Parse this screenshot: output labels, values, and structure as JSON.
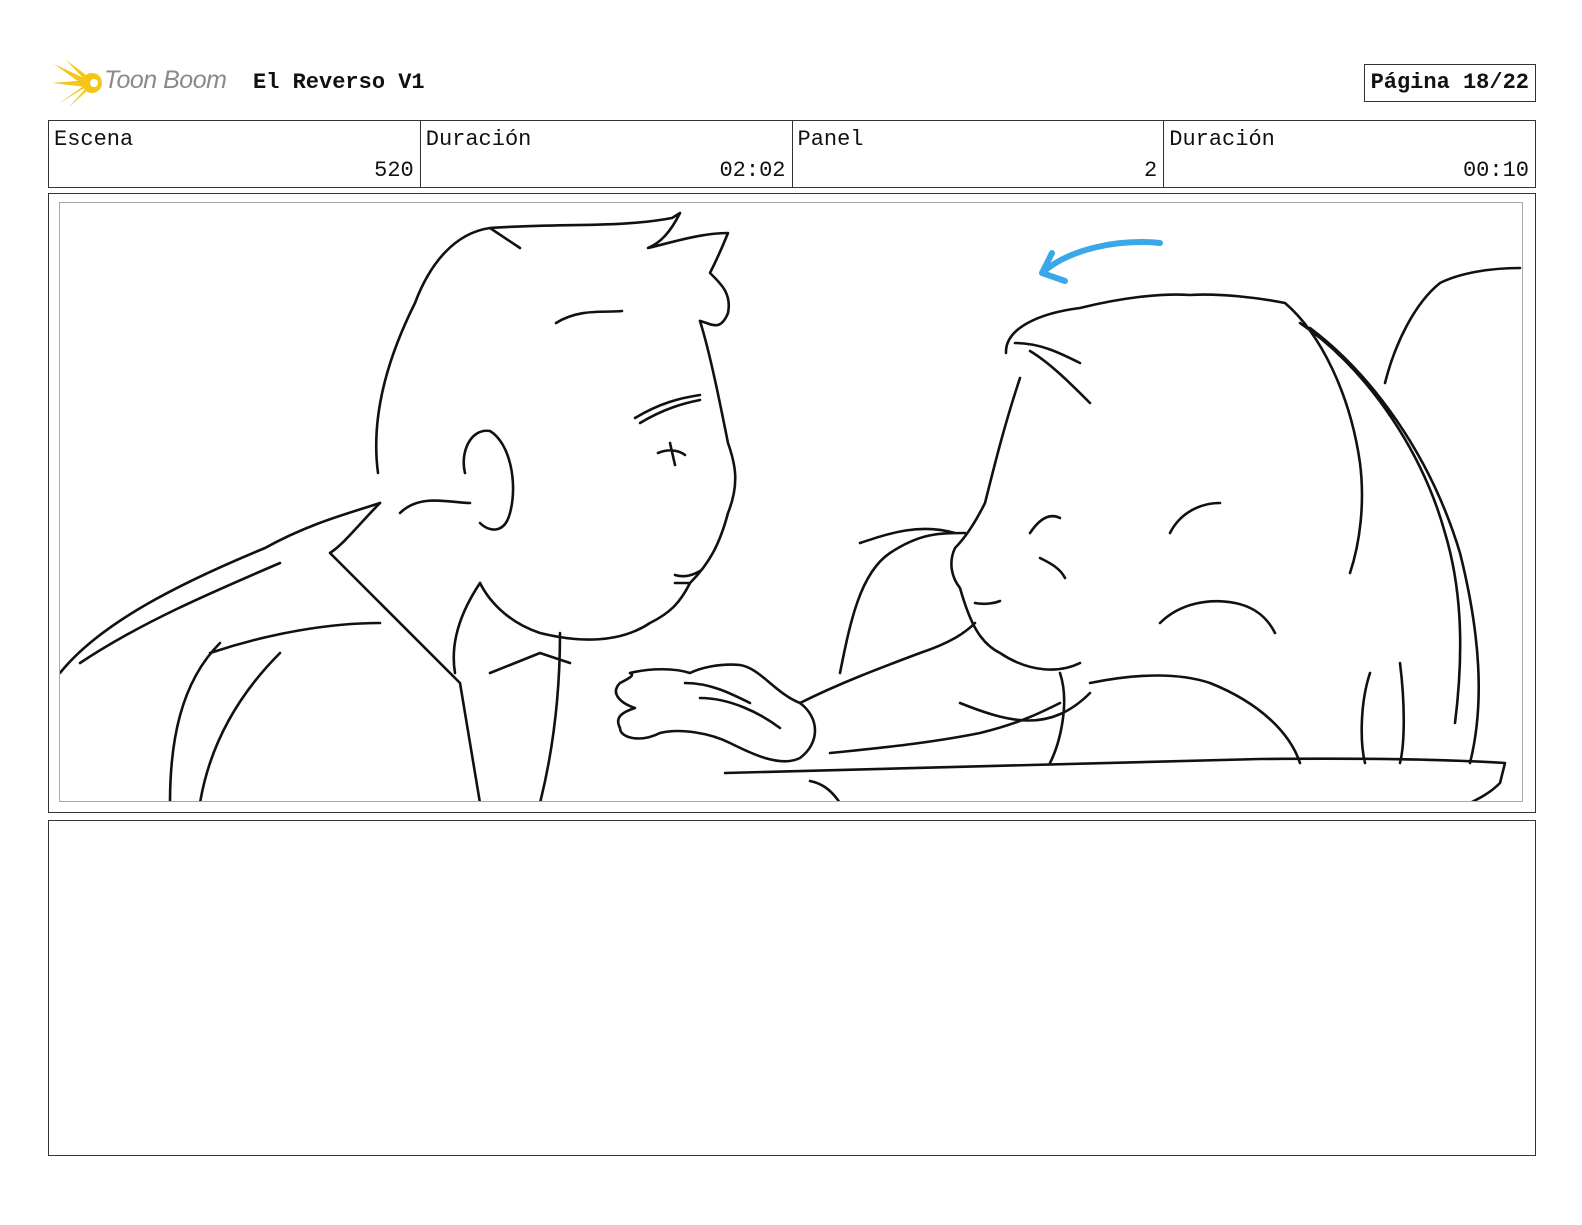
{
  "header": {
    "logo_text": "Toon Boom",
    "project_title": "El Reverso V1",
    "page_label": "Página 18/22"
  },
  "info": [
    {
      "label": "Escena",
      "value": "520"
    },
    {
      "label": "Duración",
      "value": "02:02"
    },
    {
      "label": "Panel",
      "value": "2"
    },
    {
      "label": "Duración",
      "value": "00:10"
    }
  ],
  "colors": {
    "logo_accent": "#f5c518",
    "arrow": "#3aa8e8",
    "ink": "#111111"
  },
  "notes": ""
}
